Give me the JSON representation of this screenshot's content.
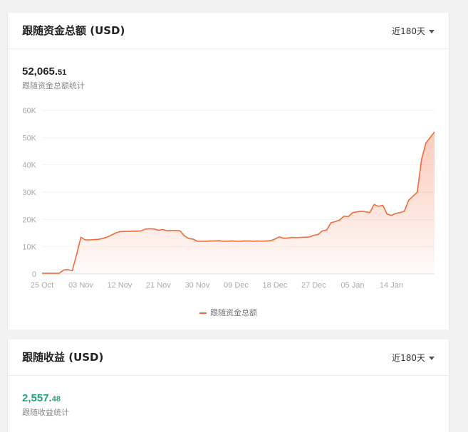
{
  "card1": {
    "title": "跟随资金总额 (USD)",
    "range": "近180天",
    "total_int": "52,065.",
    "total_dec": "51",
    "stat_label": "跟随资金总额统计"
  },
  "card2": {
    "title": "跟随收益 (USD)",
    "range": "近180天",
    "total_int": "2,557.",
    "total_dec": "48",
    "stat_label": "跟随收益统计"
  },
  "colors": {
    "line": "#f26b3a",
    "fill": "#fde3d8",
    "profit": "#22a57d"
  },
  "chart_data": {
    "type": "area",
    "title": "",
    "xlabel": "",
    "ylabel": "",
    "ylim": [
      0,
      60000
    ],
    "yticks": [
      "0",
      "10K",
      "20K",
      "30K",
      "40K",
      "50K",
      "60K"
    ],
    "xticks": [
      "25 Oct",
      "03 Nov",
      "12 Nov",
      "21 Nov",
      "30 Nov",
      "09 Dec",
      "18 Dec",
      "27 Dec",
      "05 Jan",
      "14 Jan"
    ],
    "grid": true,
    "legend_position": "bottom",
    "series": [
      {
        "name": "跟随资金总额",
        "x": [
          0,
          1,
          2,
          3,
          4,
          5,
          6,
          7,
          8,
          9,
          10,
          11,
          12,
          13,
          14,
          15,
          16,
          17,
          18,
          19,
          20,
          21,
          22,
          23,
          24,
          25,
          26,
          27,
          28,
          29,
          30,
          31,
          32,
          33,
          34,
          35,
          36,
          37,
          38,
          39,
          40,
          41,
          42,
          43,
          44,
          45,
          46,
          47,
          48,
          49,
          50,
          51,
          52,
          53,
          54,
          55,
          56,
          57,
          58,
          59,
          60,
          61,
          62,
          63,
          64,
          65,
          66,
          67,
          68,
          69,
          70,
          71,
          72,
          73,
          74,
          75,
          76,
          77,
          78,
          79,
          80,
          81,
          82,
          83,
          84,
          85,
          86,
          87,
          88,
          89,
          90,
          91
        ],
        "values": [
          300,
          300,
          300,
          300,
          300,
          1500,
          1600,
          1200,
          7000,
          13500,
          12500,
          12500,
          12600,
          12700,
          13000,
          13500,
          14200,
          15000,
          15500,
          15600,
          15600,
          15700,
          15700,
          15800,
          16500,
          16600,
          16500,
          16000,
          16300,
          15900,
          16000,
          16000,
          15800,
          14000,
          13000,
          12800,
          12000,
          12000,
          12000,
          12100,
          12100,
          12200,
          12000,
          12000,
          12100,
          12000,
          12000,
          12100,
          12100,
          12000,
          12100,
          12000,
          12100,
          12200,
          12800,
          13600,
          13100,
          13200,
          13400,
          13300,
          13400,
          13500,
          13600,
          14200,
          14500,
          15800,
          16100,
          18800,
          19200,
          19800,
          21200,
          21000,
          22500,
          22800,
          23000,
          22800,
          22500,
          25500,
          24800,
          25200,
          22000,
          21500,
          22200,
          22500,
          23000,
          27000,
          28500,
          30000,
          42000,
          48000,
          50000,
          52065
        ]
      }
    ]
  }
}
